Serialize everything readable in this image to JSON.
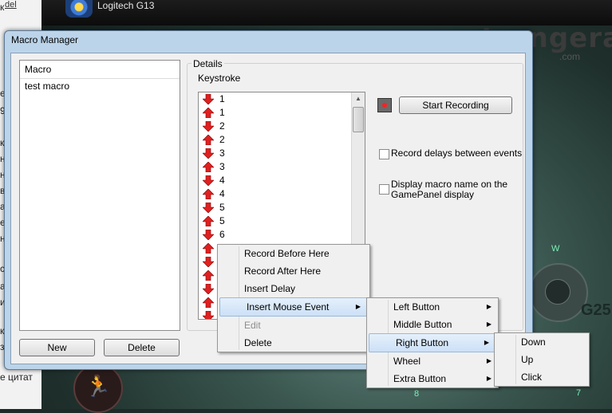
{
  "background": {
    "left_tab": "del",
    "left_fragments": [
      "к",
      "е",
      "9",
      "ко",
      "н",
      "н",
      "в",
      "а",
      "е",
      "н",
      "",
      "",
      "с",
      "а",
      "и",
      "",
      "",
      "к",
      "з"
    ],
    "bottom_left_text": "е цитат",
    "app_title": "Logitech G13",
    "watermark": "strongera",
    "watermark_suffix": ".com",
    "g25_label": "G25",
    "w_label": "W",
    "key_8": "8",
    "key_7": "7"
  },
  "window": {
    "title": "Macro Manager",
    "macro_header": "Macro",
    "macros": [
      "test macro"
    ],
    "new_button": "New",
    "delete_button": "Delete",
    "details_label": "Details",
    "keystroke_label": "Keystroke",
    "keystrokes": [
      {
        "dir": "down",
        "key": "1"
      },
      {
        "dir": "up",
        "key": "1"
      },
      {
        "dir": "down",
        "key": "2"
      },
      {
        "dir": "up",
        "key": "2"
      },
      {
        "dir": "down",
        "key": "3"
      },
      {
        "dir": "up",
        "key": "3"
      },
      {
        "dir": "down",
        "key": "4"
      },
      {
        "dir": "up",
        "key": "4"
      },
      {
        "dir": "down",
        "key": "5"
      },
      {
        "dir": "up",
        "key": "5"
      },
      {
        "dir": "down",
        "key": "6"
      },
      {
        "dir": "up",
        "key": ""
      },
      {
        "dir": "down",
        "key": ""
      },
      {
        "dir": "up",
        "key": ""
      },
      {
        "dir": "down",
        "key": ""
      },
      {
        "dir": "up",
        "key": ""
      },
      {
        "dir": "down",
        "key": ""
      }
    ],
    "start_recording": "Start Recording",
    "record_delays_label": "Record delays between events",
    "display_name_label": "Display macro name on the GamePanel display"
  },
  "context_menu": {
    "items": [
      {
        "label": "Record Before Here",
        "disabled": false,
        "submenu": false
      },
      {
        "label": "Record After Here",
        "disabled": false,
        "submenu": false
      },
      {
        "label": "Insert Delay",
        "disabled": false,
        "submenu": false
      },
      {
        "label": "Insert Mouse Event",
        "disabled": false,
        "submenu": true,
        "highlighted": true
      },
      {
        "label": "Edit",
        "disabled": true,
        "submenu": false
      },
      {
        "label": "Delete",
        "disabled": false,
        "submenu": false
      }
    ]
  },
  "mouse_menu": {
    "items": [
      {
        "label": "Left Button",
        "submenu": true
      },
      {
        "label": "Middle Button",
        "submenu": true
      },
      {
        "label": "Right Button",
        "submenu": true,
        "highlighted": true
      },
      {
        "label": "Wheel",
        "submenu": true
      },
      {
        "label": "Extra Button",
        "submenu": true
      }
    ]
  },
  "button_menu": {
    "items": [
      {
        "label": "Down"
      },
      {
        "label": "Up"
      },
      {
        "label": "Click"
      }
    ]
  },
  "colors": {
    "arrow": "#e02020",
    "highlight": "#cbe0f7",
    "window_frame": "#bcd4ea"
  }
}
